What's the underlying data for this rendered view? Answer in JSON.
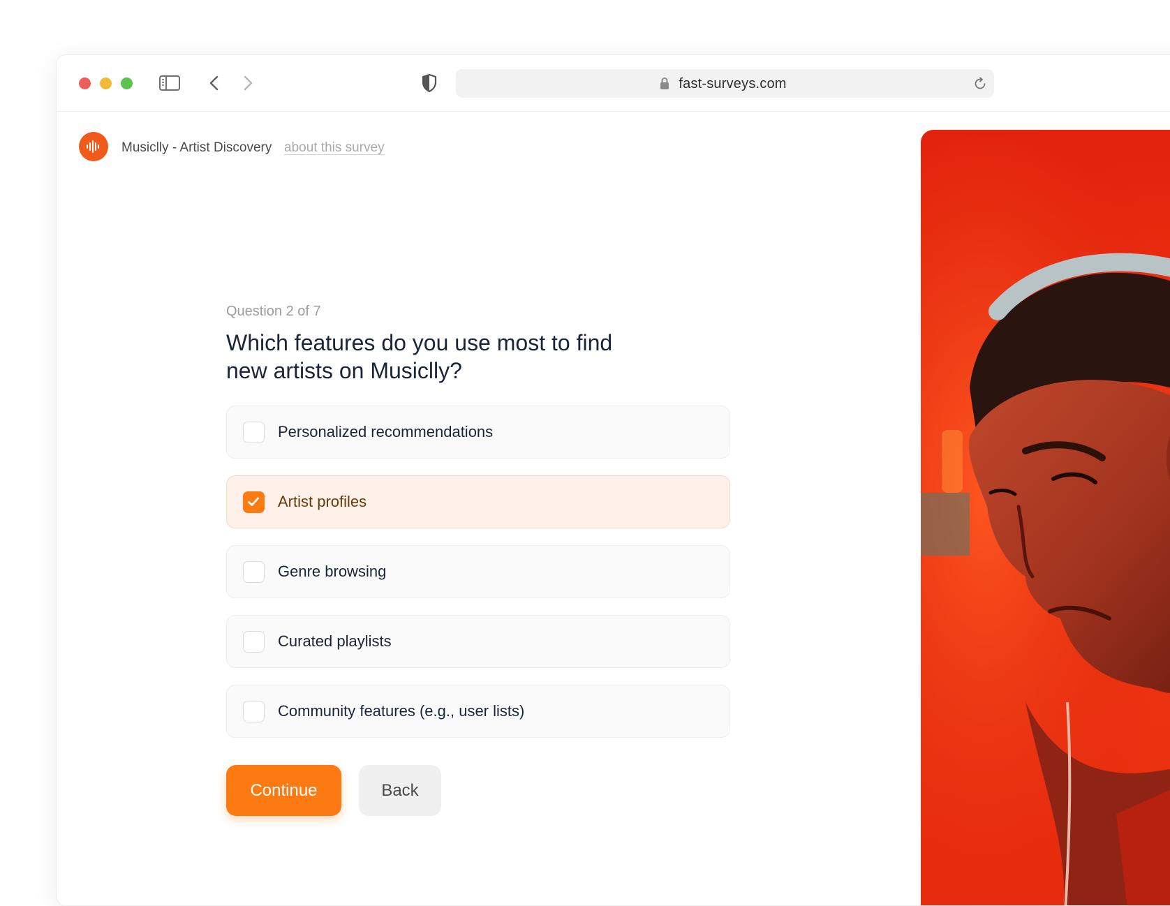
{
  "browser": {
    "url": "fast-surveys.com"
  },
  "header": {
    "brand": "Musiclly - Artist Discovery",
    "about_link": "about this survey"
  },
  "question": {
    "counter": "Question 2 of 7",
    "title": "Which features do you use most to find new artists on Musiclly?",
    "options": [
      {
        "label": "Personalized recommendations",
        "checked": false
      },
      {
        "label": "Artist profiles",
        "checked": true
      },
      {
        "label": "Genre browsing",
        "checked": false
      },
      {
        "label": "Curated playlists",
        "checked": false
      },
      {
        "label": "Community features (e.g., user lists)",
        "checked": false
      }
    ]
  },
  "actions": {
    "continue_label": "Continue",
    "back_label": "Back"
  },
  "colors": {
    "accent": "#fb7a12",
    "logo": "#f05a1a",
    "selected_bg": "#fdf1ea"
  },
  "icons": [
    "sidebar-icon",
    "chevron-left-icon",
    "chevron-right-icon",
    "shield-icon",
    "lock-icon",
    "reload-icon",
    "soundwave-icon",
    "checkmark-icon"
  ]
}
